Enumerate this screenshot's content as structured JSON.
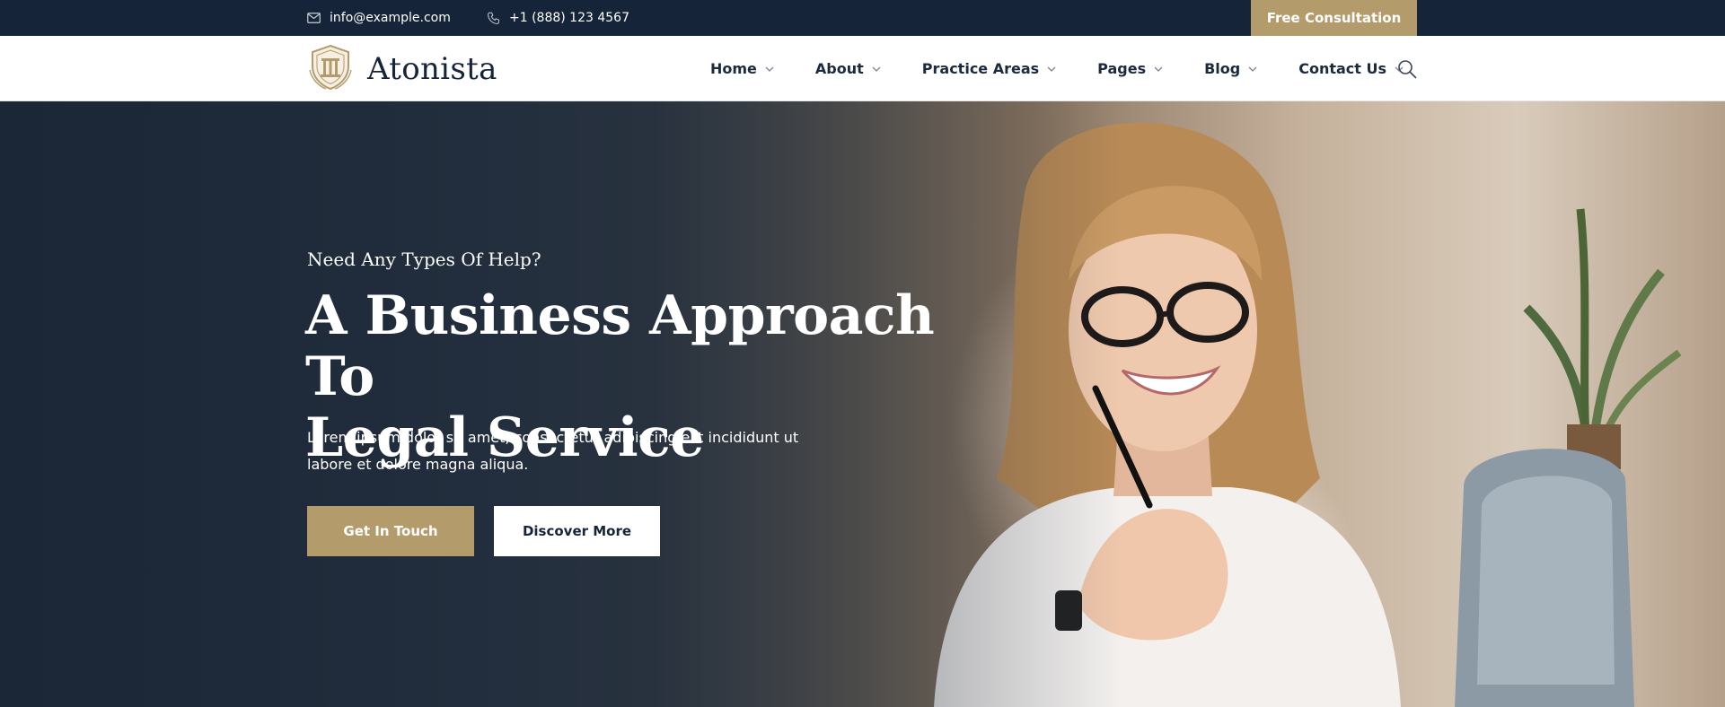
{
  "topbar": {
    "email": "info@example.com",
    "email_icon": "mail-icon",
    "phone": "+1 (888) 123 4567",
    "phone_icon": "phone-icon",
    "cta_label": "Free Consultation"
  },
  "brand": {
    "name": "Atonista",
    "logo_icon": "pillar-shield-icon"
  },
  "nav": {
    "items": [
      {
        "label": "Home"
      },
      {
        "label": "About"
      },
      {
        "label": "Practice Areas"
      },
      {
        "label": "Pages"
      },
      {
        "label": "Blog"
      },
      {
        "label": "Contact Us"
      }
    ],
    "search_icon": "search-icon"
  },
  "hero": {
    "eyebrow": "Need Any Types Of Help?",
    "title_line1": "A Business Approach To",
    "title_line2": "Legal Service",
    "description": "Lorem ipsum dolor sit amet, consectetur adipiscing elit incididunt ut labore et dolore magna aliqua.",
    "primary_button": "Get In Touch",
    "secondary_button": "Discover More"
  },
  "colors": {
    "navy": "#152438",
    "gold": "#b49b6b",
    "white": "#ffffff"
  }
}
